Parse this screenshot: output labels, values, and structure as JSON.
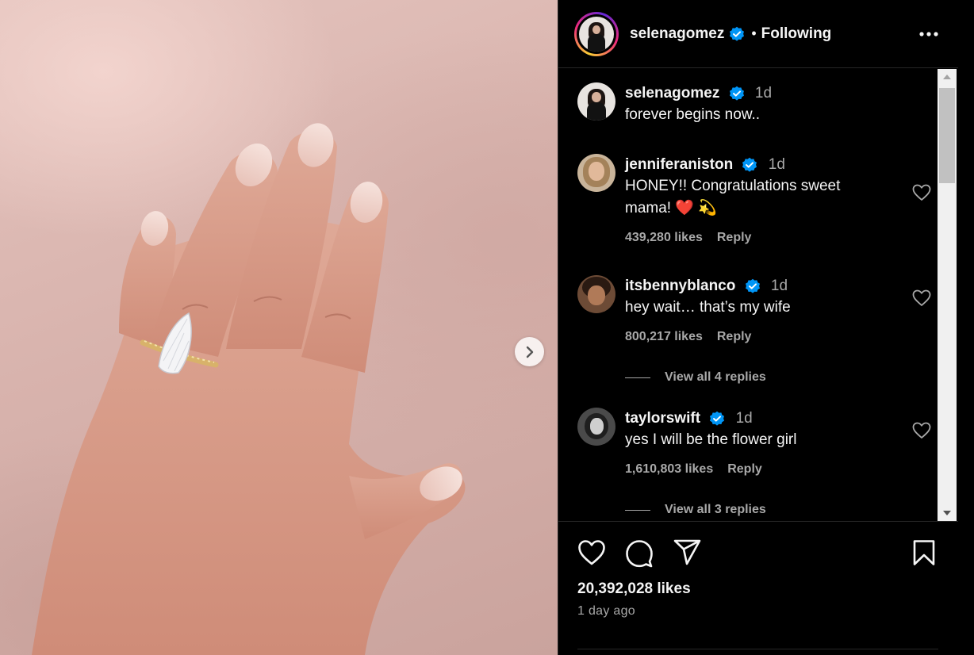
{
  "post": {
    "author": "selenagomez",
    "follow_status": "Following",
    "separator": "•",
    "likes": "20,392,028 likes",
    "posted_ago": "1 day ago"
  },
  "caption": {
    "username": "selenagomez",
    "time": "1d",
    "text": "forever begins now.."
  },
  "comments": [
    {
      "username": "jenniferaniston",
      "time": "1d",
      "text": "HONEY!! Congratulations sweet mama! ❤️ 💫",
      "likes": "439,280 likes",
      "reply": "Reply",
      "avatar": "jenniferaniston-avatar"
    },
    {
      "username": "itsbennyblanco",
      "time": "1d",
      "text": "hey wait… that’s my wife",
      "likes": "800,217 likes",
      "reply": "Reply",
      "avatar": "itsbennyblanco-avatar",
      "view_replies": "View all 4 replies"
    },
    {
      "username": "taylorswift",
      "time": "1d",
      "text": "yes I will be the flower girl",
      "likes": "1,610,803 likes",
      "reply": "Reply",
      "avatar": "taylorswift-avatar",
      "view_replies": "View all 3 replies"
    }
  ],
  "icons": {
    "more": "more-horizontal-icon",
    "verified": "verified-badge-icon",
    "like": "heart-icon",
    "comment": "comment-bubble-icon",
    "share": "paper-plane-icon",
    "save": "bookmark-icon",
    "next": "chevron-right-icon"
  },
  "colors": {
    "background": "#000000",
    "text": "#f5f5f5",
    "secondary_text": "#a8a8a8",
    "verified_blue": "#0095f6",
    "divider": "#262626"
  }
}
